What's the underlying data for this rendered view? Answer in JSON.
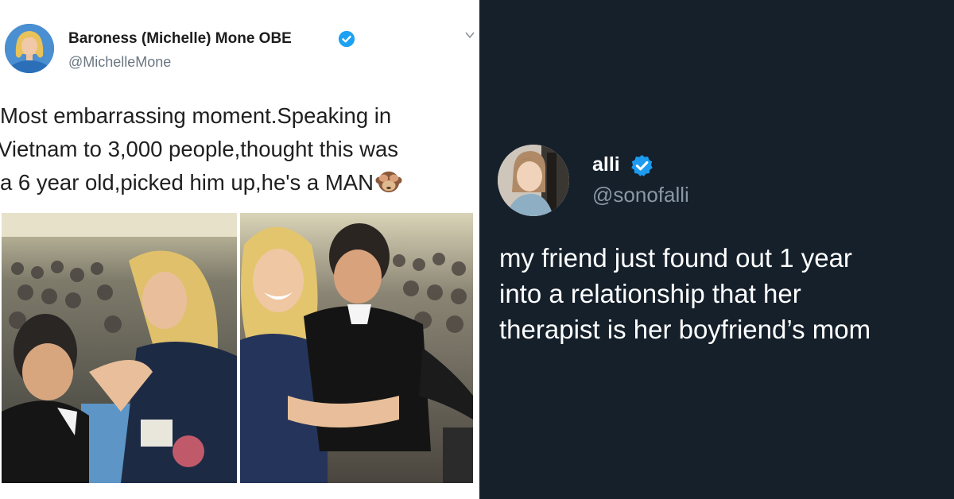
{
  "left_tweet": {
    "display_name": "Baroness (Michelle) Mone OBE",
    "handle": "@MichelleMone",
    "text_lines": [
      "Most embarrassing moment.Speaking in",
      "Vietnam to 3,000 people,thought this was",
      "a 6 year old,picked him up,he's a MAN"
    ],
    "emoji": "see-no-evil-monkey",
    "verified_color": "#1da1f2"
  },
  "right_tweet": {
    "display_name": "alli",
    "handle": "@sonofalli",
    "text_lines": [
      "my friend just found out 1 year",
      "into a relationship that her",
      "therapist is her boyfriend’s mom"
    ],
    "verified_color": "#1d9bf0",
    "background": "#15202b"
  }
}
